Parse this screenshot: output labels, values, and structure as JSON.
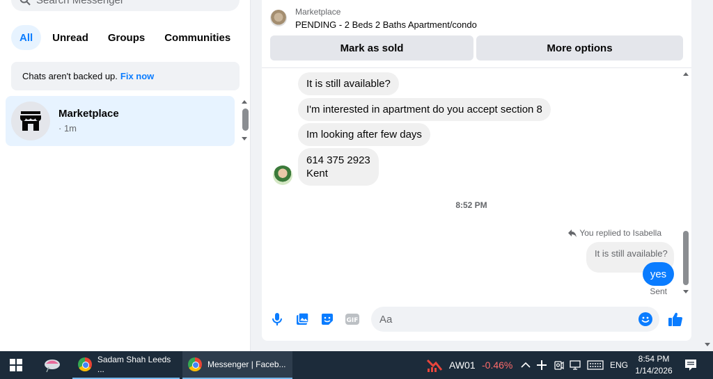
{
  "left_panel": {
    "search_placeholder": "Search Messenger",
    "filters": [
      "All",
      "Unread",
      "Groups",
      "Communities"
    ],
    "notice_text": "Chats aren't backed up.",
    "notice_link": "Fix now",
    "chat": {
      "title": "Marketplace",
      "time": "· 1m"
    }
  },
  "conversation": {
    "marketplace_label": "Marketplace",
    "listing_title": "PENDING - 2 Beds 2 Baths Apartment/condo",
    "mark_sold": "Mark as sold",
    "more_options": "More options",
    "incoming": [
      "It is still available?",
      "I'm interested in apartment do you accept section 8",
      "Im looking after few days"
    ],
    "contact_line1": "614 375 2923",
    "contact_line2": "Kent",
    "timestamp": "8:52 PM",
    "replied_label": "You replied to Isabella",
    "quoted_text": "It is still available?",
    "my_message": "yes",
    "status": "Sent",
    "input_placeholder": "Aa"
  },
  "taskbar": {
    "app1": "Sadam Shah Leeds ...",
    "app2": "Messenger | Faceb...",
    "stock_name": "AW01",
    "stock_change": "-0.46%",
    "language": "ENG",
    "time": "8:54 PM",
    "date": "1/14/2026"
  },
  "colors": {
    "accent": "#0a7cff",
    "negative": "#ff6b6b",
    "taskbar": "#1c2b3a"
  }
}
